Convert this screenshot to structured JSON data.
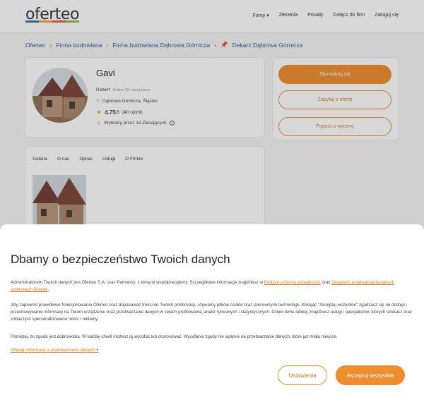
{
  "header": {
    "logo": "oferteo",
    "nav": {
      "firms": "Firmy ▾",
      "orders": "Zlecenia",
      "advice": "Porady",
      "join": "Dołącz do firm",
      "login": "Zaloguj się"
    }
  },
  "breadcrumb": [
    "Oferteo",
    "Firma budowlana",
    "Firma budowlana Dąbrowa Górnicza",
    "Dekarz Dąbrowa Górnicza"
  ],
  "profile": {
    "name": "Gavi",
    "owner": "Robert",
    "online": "Online 16 minut temu",
    "location": "Dąbrowa Górnicza, Śląskie",
    "rating": "4.75",
    "rating_scale": "/5",
    "reviews": "(40 opinii)",
    "chosen_by": "Wybrany przez 14 Zlecających"
  },
  "actions": {
    "contact": "Skontaktuj się",
    "ask_offer": "Zapytaj o ofertę",
    "ask_quote": "Poproś o wycenę"
  },
  "tabs": [
    "Galeria",
    "O nas",
    "Opinie",
    "Usługi",
    "O Firmie"
  ],
  "consent": {
    "title": "Dbamy o bezpieczeństwo Twoich danych",
    "p1_start": "Administratorem Twoich danych jest Oferteo S.A. oraz Partnerzy, z którymi współpracujemy. Szczegółowe informacje znajdziesz w ",
    "p1_link1": "Polityce ochrony prywatności",
    "p1_mid": " oraz ",
    "p1_link2": "Zasadach przetwarzania danych osobowych Google",
    "p1_end": ".",
    "p2": "Aby zapewnić prawidłowe funkcjonowanie Oferteo oraz dopasować treści do Twoich preferencji, używamy plików cookie oraz pokrewnych technologii. Klikając \"Akceptuj wszystkie\" zgadzasz się na dostęp i przechowywanie informacji na Twoim urządzeniu oraz przetwarzanie danych w celach profilowania, analiz rynkowych i statystycznych. Dzięki temu łatwiej znajdziesz usługi i specjalistów, których szukasz oraz zobaczysz spersonalizowane treści i reklamy.",
    "p3": "Pamiętaj, że zgoda jest dobrowolna. W każdej chwili możesz ją wycofać lub dostosować. Wycofanie zgody nie wpłynie na przetwarzanie danych, które już miało miejsce.",
    "more_info": "Więcej informacji o przetwarzaniu danych",
    "settings_label": "Ustawienia",
    "accept_label": "Akceptuj wszystkie"
  },
  "colors": {
    "accent": "#ef8c2e",
    "link": "#2f5d9b"
  }
}
